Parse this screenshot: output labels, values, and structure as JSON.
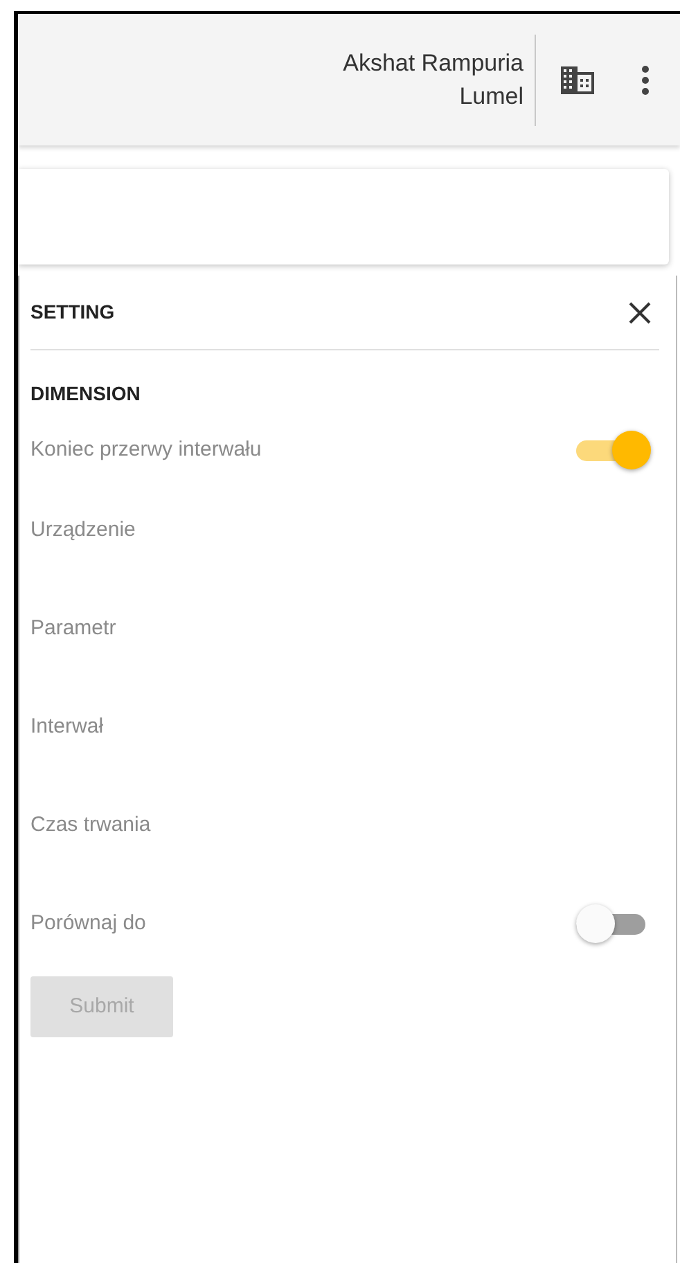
{
  "header": {
    "user_name": "Akshat Rampuria",
    "organization": "Lumel"
  },
  "panel": {
    "title": "SETTING",
    "section": "DIMENSION",
    "rows": [
      {
        "kind": "toggle",
        "label": "Koniec przerwy interwału",
        "on": true
      },
      {
        "kind": "field",
        "label": "Urządzenie"
      },
      {
        "kind": "field",
        "label": "Parametr"
      },
      {
        "kind": "field",
        "label": "Interwał"
      },
      {
        "kind": "field",
        "label": "Czas trwania"
      },
      {
        "kind": "toggle",
        "label": "Porównaj do",
        "on": false
      }
    ],
    "submit": {
      "label": "Submit",
      "disabled": true
    }
  }
}
